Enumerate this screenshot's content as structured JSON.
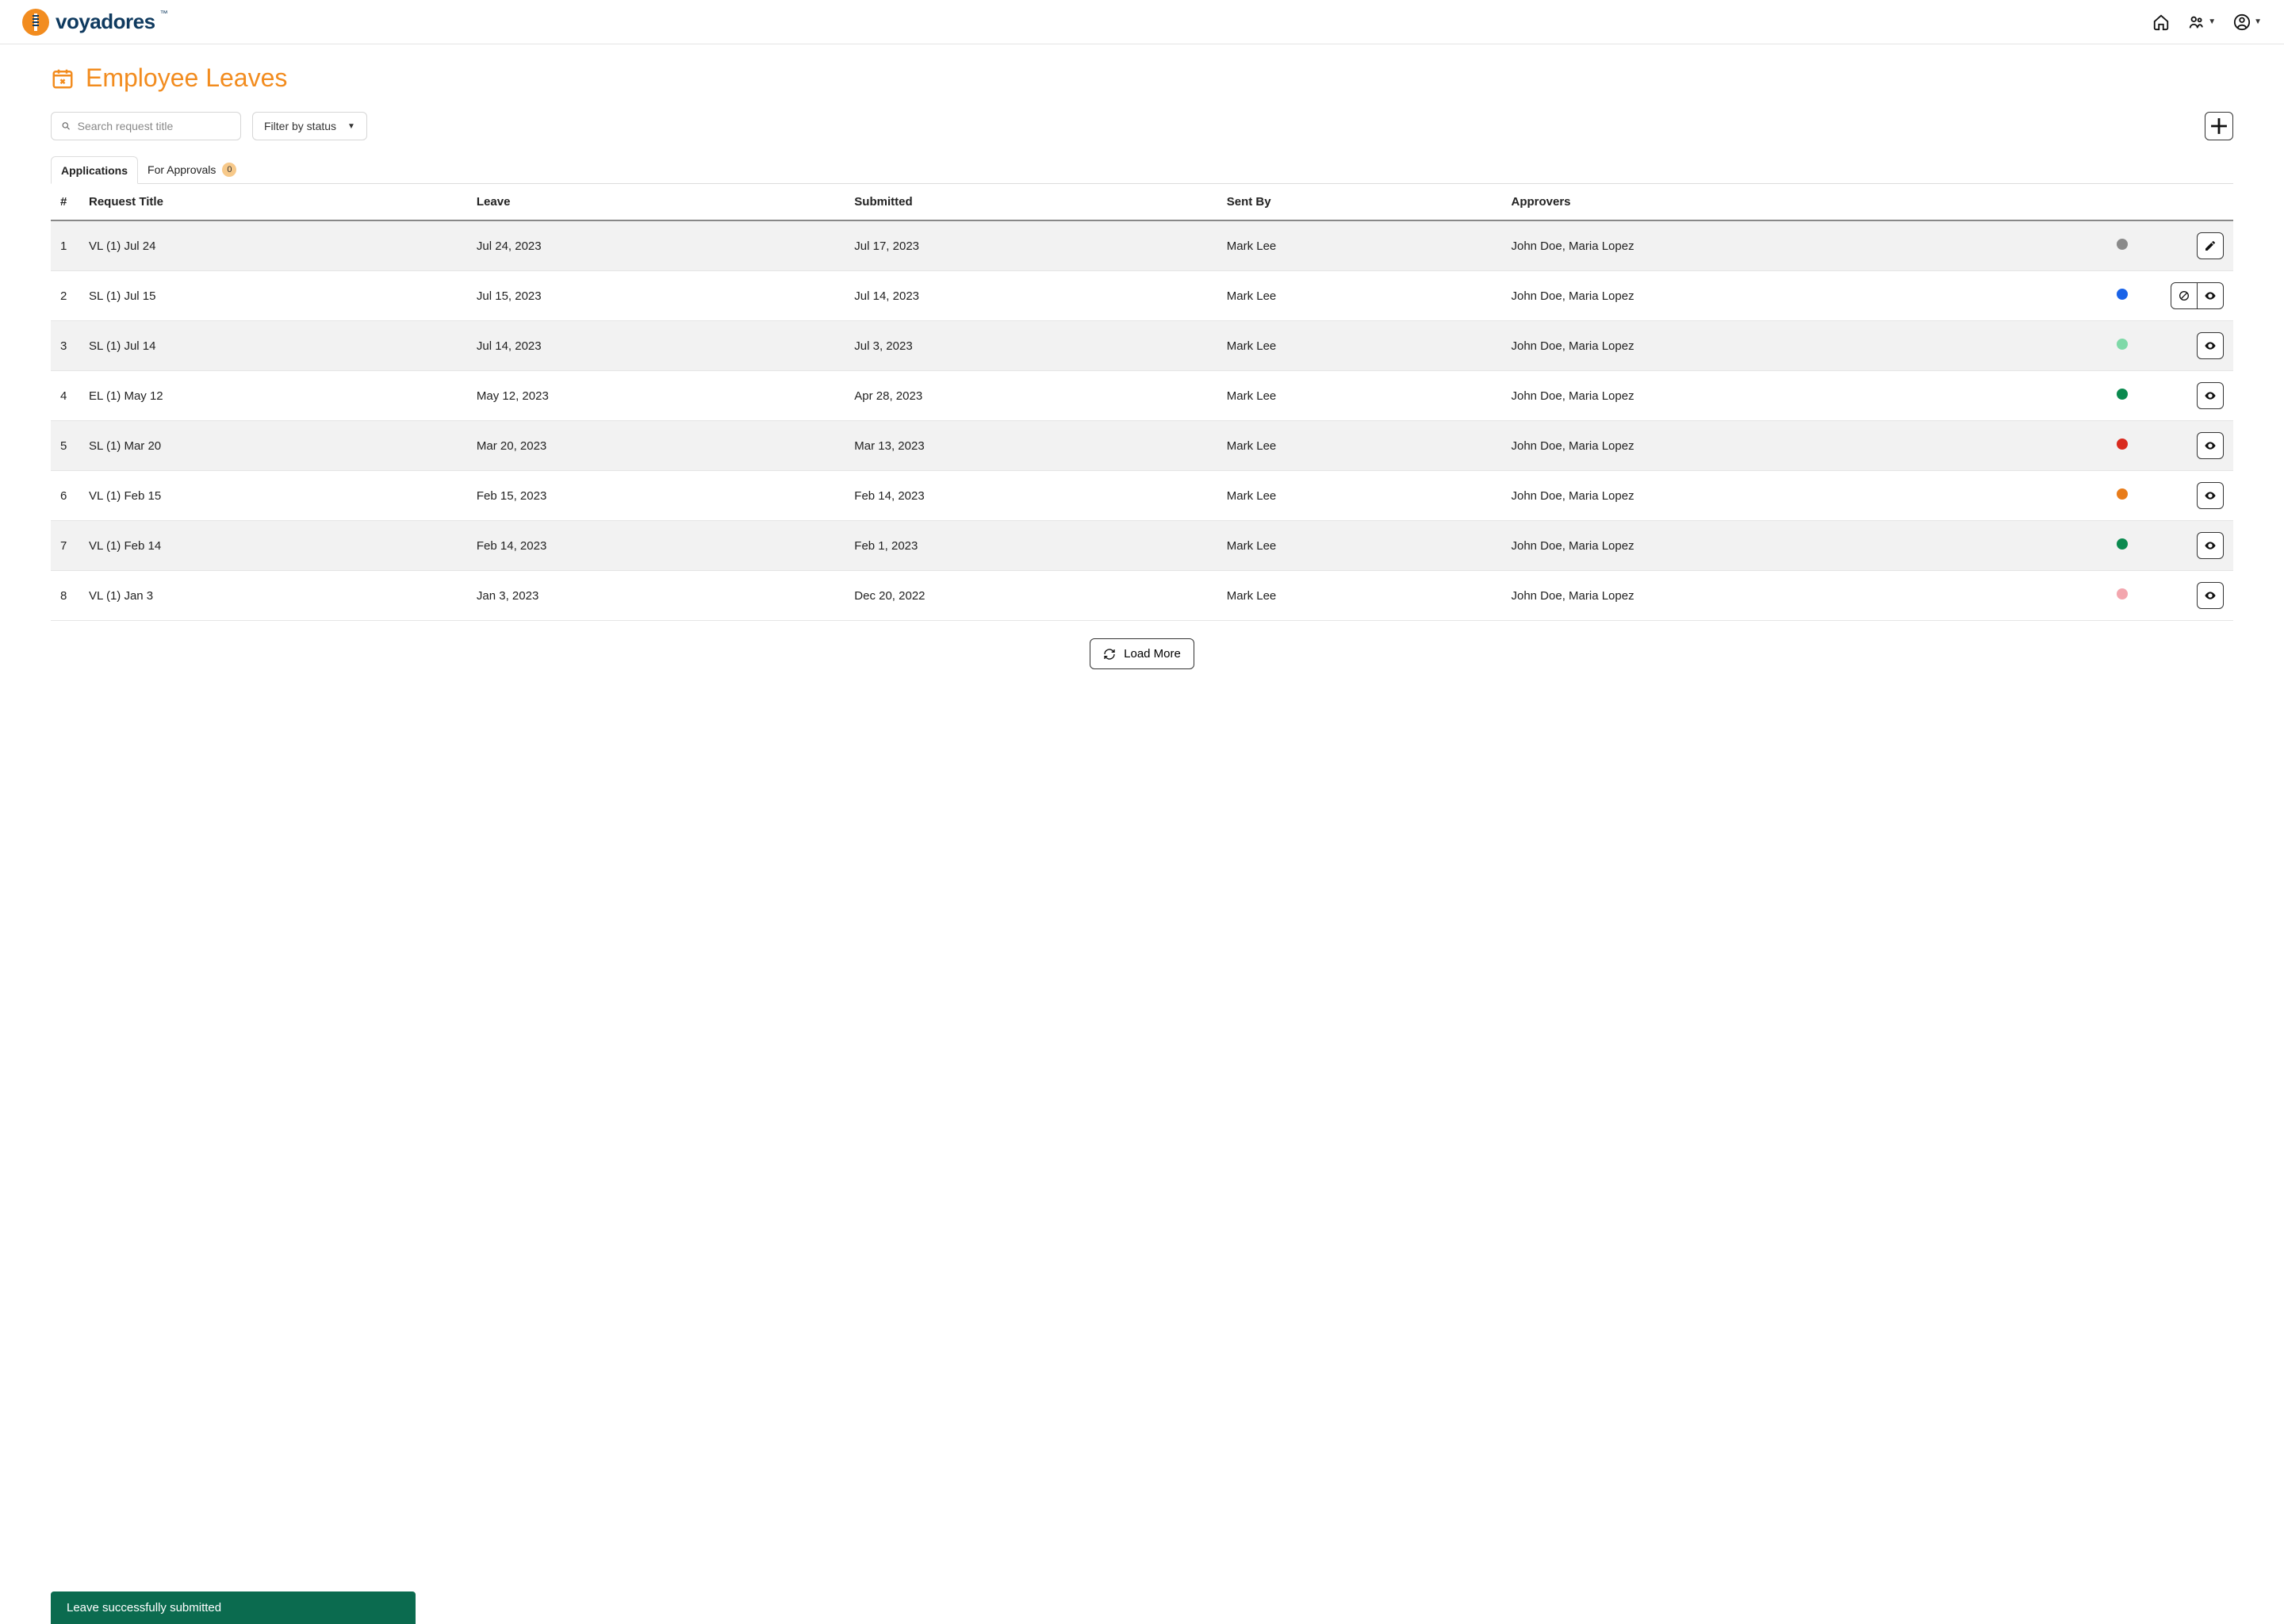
{
  "brand": {
    "name": "voyadores",
    "tm": "™"
  },
  "page": {
    "title": "Employee Leaves"
  },
  "search": {
    "placeholder": "Search request title"
  },
  "filter": {
    "label": "Filter by status"
  },
  "tabs": [
    {
      "label": "Applications",
      "active": true
    },
    {
      "label": "For Approvals",
      "active": false,
      "badge": "0"
    }
  ],
  "columns": [
    "#",
    "Request Title",
    "Leave",
    "Submitted",
    "Sent By",
    "Approvers"
  ],
  "status_colors": {
    "gray": "#8a8a8a",
    "blue": "#1a63e8",
    "mint": "#7fd9a8",
    "green": "#0b8a4f",
    "red": "#d92b1f",
    "orange": "#e87c1a",
    "pink": "#f3a6ae"
  },
  "rows": [
    {
      "n": "1",
      "title": "VL (1) Jul 24",
      "leave": "Jul 24, 2023",
      "submitted": "Jul 17, 2023",
      "sent_by": "Mark Lee",
      "approvers": "John Doe, Maria Lopez",
      "status": "gray",
      "actions": [
        "edit"
      ]
    },
    {
      "n": "2",
      "title": "SL (1) Jul 15",
      "leave": "Jul 15, 2023",
      "submitted": "Jul 14, 2023",
      "sent_by": "Mark Lee",
      "approvers": "John Doe, Maria Lopez",
      "status": "blue",
      "actions": [
        "cancel",
        "view"
      ]
    },
    {
      "n": "3",
      "title": "SL (1) Jul 14",
      "leave": "Jul 14, 2023",
      "submitted": "Jul 3, 2023",
      "sent_by": "Mark Lee",
      "approvers": "John Doe, Maria Lopez",
      "status": "mint",
      "actions": [
        "view"
      ]
    },
    {
      "n": "4",
      "title": "EL (1) May 12",
      "leave": "May 12, 2023",
      "submitted": "Apr 28, 2023",
      "sent_by": "Mark Lee",
      "approvers": "John Doe, Maria Lopez",
      "status": "green",
      "actions": [
        "view"
      ]
    },
    {
      "n": "5",
      "title": "SL (1) Mar 20",
      "leave": "Mar 20, 2023",
      "submitted": "Mar 13, 2023",
      "sent_by": "Mark Lee",
      "approvers": "John Doe, Maria Lopez",
      "status": "red",
      "actions": [
        "view"
      ]
    },
    {
      "n": "6",
      "title": "VL (1) Feb 15",
      "leave": "Feb 15, 2023",
      "submitted": "Feb 14, 2023",
      "sent_by": "Mark Lee",
      "approvers": "John Doe, Maria Lopez",
      "status": "orange",
      "actions": [
        "view"
      ]
    },
    {
      "n": "7",
      "title": "VL (1) Feb 14",
      "leave": "Feb 14, 2023",
      "submitted": "Feb 1, 2023",
      "sent_by": "Mark Lee",
      "approvers": "John Doe, Maria Lopez",
      "status": "green",
      "actions": [
        "view"
      ]
    },
    {
      "n": "8",
      "title": "VL (1) Jan 3",
      "leave": "Jan 3, 2023",
      "submitted": "Dec 20, 2022",
      "sent_by": "Mark Lee",
      "approvers": "John Doe, Maria Lopez",
      "status": "pink",
      "actions": [
        "view"
      ]
    }
  ],
  "load_more": "Load More",
  "toast": "Leave successfully submitted"
}
